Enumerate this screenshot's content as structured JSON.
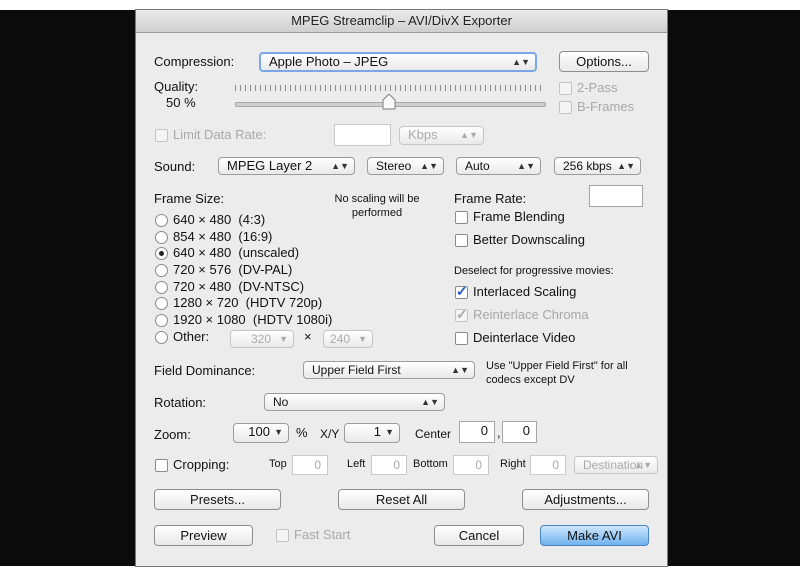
{
  "window": {
    "title": "MPEG Streamclip – AVI/DivX Exporter"
  },
  "compression": {
    "label": "Compression:",
    "value": "Apple Photo – JPEG",
    "options_button": "Options..."
  },
  "quality": {
    "label": "Quality:",
    "value_text": "50 %",
    "value": 0.5
  },
  "two_pass": {
    "label": "2-Pass",
    "checked": false,
    "enabled": false
  },
  "b_frames": {
    "label": "B-Frames",
    "checked": false,
    "enabled": false
  },
  "limit_data_rate": {
    "label": "Limit Data Rate:",
    "value": "",
    "unit": "Kbps",
    "checked": false,
    "enabled": false
  },
  "sound": {
    "label": "Sound:",
    "codec": "MPEG Layer 2",
    "channels": "Stereo",
    "rate": "Auto",
    "bitrate": "256 kbps"
  },
  "frame_size": {
    "label": "Frame Size:",
    "note": "No scaling will be performed",
    "options": [
      "640 × 480  (4:3)",
      "854 × 480  (16:9)",
      "640 × 480  (unscaled)",
      "720 × 576  (DV-PAL)",
      "720 × 480  (DV-NTSC)",
      "1280 × 720  (HDTV 720p)",
      "1920 × 1080  (HDTV 1080i)"
    ],
    "selected_index": 2,
    "other_label": "Other:",
    "other_width": "320",
    "other_times": "×",
    "other_height": "240"
  },
  "frame_rate": {
    "label": "Frame Rate:",
    "value": ""
  },
  "frame_blending": {
    "label": "Frame Blending",
    "checked": false
  },
  "better_downscaling": {
    "label": "Better Downscaling",
    "checked": false
  },
  "progressive_note": "Deselect for progressive movies:",
  "interlaced_scaling": {
    "label": "Interlaced Scaling",
    "checked": true
  },
  "reinterlace_chroma": {
    "label": "Reinterlace Chroma",
    "checked": true,
    "enabled": false
  },
  "deinterlace_video": {
    "label": "Deinterlace Video",
    "checked": false
  },
  "field_dominance": {
    "label": "Field Dominance:",
    "value": "Upper Field First",
    "note": "Use \"Upper Field First\" for all codecs except DV"
  },
  "rotation": {
    "label": "Rotation:",
    "value": "No"
  },
  "zoom": {
    "label": "Zoom:",
    "value": "100",
    "unit": "%",
    "xy_label": "X/Y",
    "xy_value": "1",
    "center_label": "Center",
    "center_x": "0",
    "center_sep": ",",
    "center_y": "0"
  },
  "cropping": {
    "label": "Cropping:",
    "checked": false,
    "top_label": "Top",
    "top": "0",
    "left_label": "Left",
    "left": "0",
    "bottom_label": "Bottom",
    "bottom": "0",
    "right_label": "Right",
    "right": "0",
    "destination": "Destination"
  },
  "buttons": {
    "presets": "Presets...",
    "reset_all": "Reset All",
    "adjustments": "Adjustments...",
    "preview": "Preview",
    "fast_start": "Fast Start",
    "cancel": "Cancel",
    "make_avi": "Make AVI"
  }
}
